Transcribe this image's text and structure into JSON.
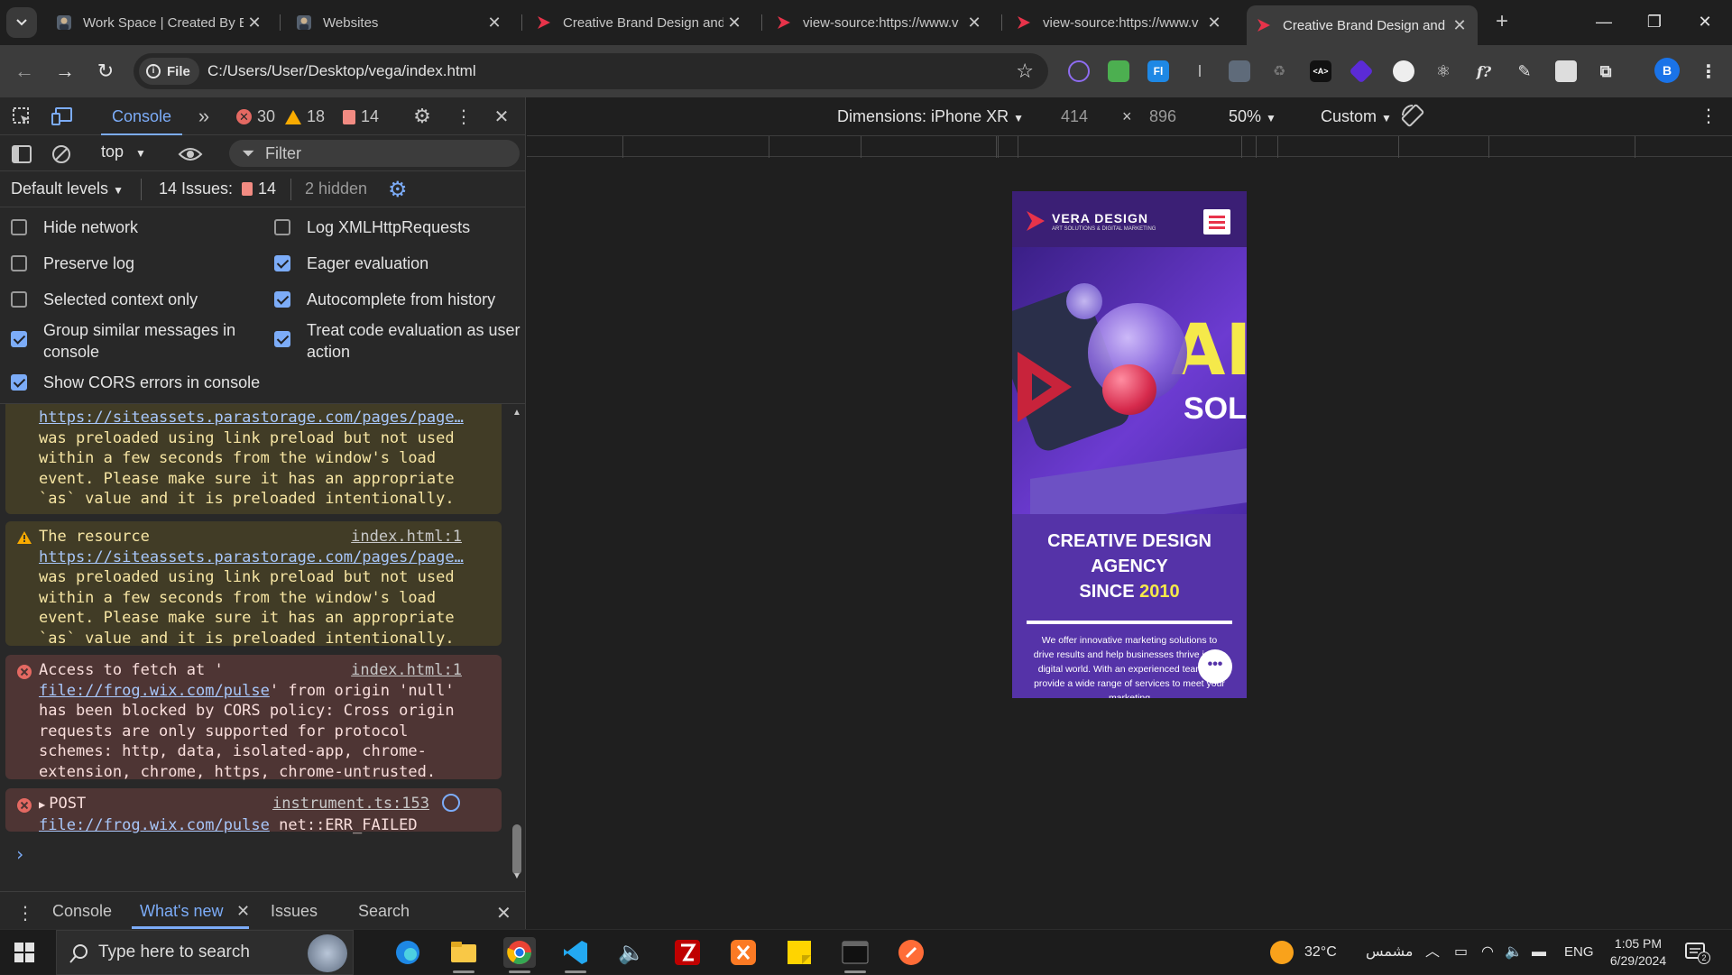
{
  "browser": {
    "tabs": [
      {
        "title": "Work Space | Created By Er",
        "active": false
      },
      {
        "title": "Websites",
        "active": false
      },
      {
        "title": "Creative Brand Design and",
        "active": false
      },
      {
        "title": "view-source:https://www.v",
        "active": false
      },
      {
        "title": "view-source:https://www.v",
        "active": false
      },
      {
        "title": "Creative Brand Design and",
        "active": true
      }
    ],
    "address": {
      "chip_label": "File",
      "url": "C:/Users/User/Desktop/vega/index.html"
    },
    "profile_initial": "B"
  },
  "devtools": {
    "active_tab": "Console",
    "counts": {
      "errors": "30",
      "warnings": "18",
      "issues": "14"
    },
    "context": "top",
    "filter_placeholder": "Filter",
    "levels_label": "Default levels",
    "issues_label": "14 Issues:",
    "issues_count": "14",
    "hidden_label": "2 hidden",
    "settings": [
      {
        "label": "Hide network",
        "checked": false
      },
      {
        "label": "Log XMLHttpRequests",
        "checked": false
      },
      {
        "label": "Preserve log",
        "checked": false
      },
      {
        "label": "Eager evaluation",
        "checked": true
      },
      {
        "label": "Selected context only",
        "checked": false
      },
      {
        "label": "Autocomplete from history",
        "checked": true
      },
      {
        "label": "Group similar messages in console",
        "checked": true
      },
      {
        "label": "Treat code evaluation as user action",
        "checked": true
      },
      {
        "label": "Show CORS errors in console",
        "checked": true
      }
    ],
    "messages": [
      {
        "level": "warning",
        "link": "https://siteassets.parastorage.com/pages/page…",
        "text": "was preloaded using link preload but not used within a few seconds from the window's load event. Please make sure it has an appropriate `as` value and it is preloaded intentionally."
      },
      {
        "level": "warning",
        "prefix": "The resource",
        "source": "index.html:1",
        "link": "https://siteassets.parastorage.com/pages/page…",
        "text": "was preloaded using link preload but not used within a few seconds from the window's load event. Please make sure it has an appropriate `as` value and it is preloaded intentionally."
      },
      {
        "level": "error",
        "prefix": "Access to fetch at '",
        "source": "index.html:1",
        "link": "file://frog.wix.com/pulse",
        "text": "' from origin 'null' has been blocked by CORS policy: Cross origin requests are only supported for protocol schemes: http, data, isolated-app, chrome-extension, chrome, https, chrome-untrusted."
      },
      {
        "level": "error",
        "prefix": "POST",
        "source": "instrument.ts:153",
        "link": "file://frog.wix.com/pulse",
        "text": "net::ERR_FAILED"
      }
    ],
    "prompt": "›",
    "drawer_tabs": [
      "Console",
      "What's new",
      "Issues",
      "Search"
    ],
    "drawer_active": "What's new"
  },
  "device_toolbar": {
    "dimensions_label": "Dimensions: iPhone XR",
    "width": "414",
    "times": "×",
    "height": "896",
    "zoom": "50%",
    "throttle": "Custom"
  },
  "phone_page": {
    "logo": "VERA DESIGN",
    "logo_tagline": "ART SOLUTIONS & DIGITAL MARKETING",
    "headline_lines": [
      "CREATIVE DESIGN",
      "AGENCY"
    ],
    "since_prefix": "SINCE",
    "since_year": "2010",
    "body_text": "We offer innovative marketing solutions to drive results and help businesses thrive in the digital world. With an experienced team, we provide a wide range of services to meet your marketing",
    "hero_letters_1": "AI",
    "hero_letters_2": "SOLU",
    "colors": {
      "accent_yellow": "#f5e94a",
      "purple": "#5533a8"
    }
  },
  "taskbar": {
    "search_placeholder": "Type here to search",
    "weather": "32°C",
    "weather_desc": "مشمس",
    "language": "ENG",
    "time": "1:05 PM",
    "date": "6/29/2024",
    "notification_count": "2"
  }
}
